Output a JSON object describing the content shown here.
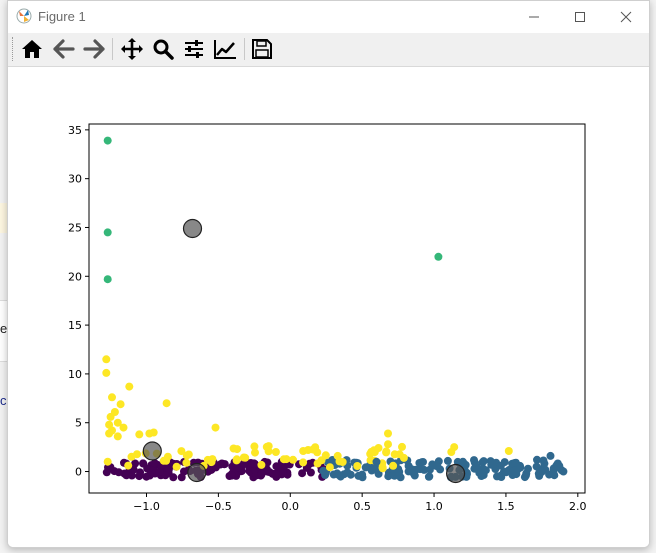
{
  "window": {
    "title": "Figure 1"
  },
  "background": {
    "fragment_1": "e",
    "fragment_2": "ch"
  },
  "toolbar": {
    "buttons": [
      {
        "name": "home-button",
        "icon": "home-icon"
      },
      {
        "name": "back-button",
        "icon": "arrow-left-icon"
      },
      {
        "name": "forward-button",
        "icon": "arrow-right-icon"
      },
      {
        "name": "pan-button",
        "icon": "move-icon"
      },
      {
        "name": "zoom-button",
        "icon": "magnifier-icon"
      },
      {
        "name": "subplots-button",
        "icon": "sliders-icon"
      },
      {
        "name": "edit-axis-button",
        "icon": "chart-line-icon"
      },
      {
        "name": "save-button",
        "icon": "floppy-disk-icon"
      }
    ]
  },
  "colors": {
    "purple": "#440154",
    "blue": "#30688e",
    "green": "#35b779",
    "yellow": "#fde725",
    "centroid": "#555555"
  },
  "chart_data": {
    "type": "scatter",
    "xlim": [
      -1.4,
      2.05
    ],
    "ylim": [
      -2.2,
      35.6
    ],
    "x_ticks": [
      -1.0,
      -0.5,
      0.0,
      0.5,
      1.0,
      1.5,
      2.0
    ],
    "x_tick_labels": [
      "−1.0",
      "−0.5",
      "0.0",
      "0.5",
      "1.0",
      "1.5",
      "2.0"
    ],
    "y_ticks": [
      0,
      5,
      10,
      15,
      20,
      25,
      30,
      35
    ],
    "y_tick_labels": [
      "0",
      "5",
      "10",
      "15",
      "20",
      "25",
      "30",
      "35"
    ],
    "grid": false,
    "clusters": [
      {
        "color": "purple",
        "x_range": [
          -1.29,
          0.26
        ],
        "y_range": [
          -0.6,
          1.0
        ],
        "count": 140
      },
      {
        "color": "blue",
        "x_range": [
          0.22,
          1.9
        ],
        "y_range": [
          -0.6,
          1.2
        ],
        "count": 140
      },
      {
        "color": "yellow",
        "x_range": [
          -1.29,
          0.8
        ],
        "y_range": [
          0.3,
          2.6
        ],
        "count": 60
      }
    ],
    "points": {
      "green": [
        [
          -1.27,
          33.9
        ],
        [
          -1.27,
          24.5
        ],
        [
          -1.27,
          19.7
        ],
        [
          1.03,
          22.0
        ]
      ],
      "yellow": [
        [
          -1.28,
          11.5
        ],
        [
          -1.28,
          10.1
        ],
        [
          -1.12,
          8.7
        ],
        [
          -0.86,
          7.0
        ],
        [
          -1.24,
          7.6
        ],
        [
          -1.18,
          6.9
        ],
        [
          -1.22,
          6.1
        ],
        [
          -1.25,
          5.6
        ],
        [
          -1.2,
          5.0
        ],
        [
          -1.26,
          4.8
        ],
        [
          -1.16,
          4.5
        ],
        [
          -1.24,
          4.2
        ],
        [
          -1.26,
          3.9
        ],
        [
          -1.2,
          3.6
        ],
        [
          -1.05,
          3.8
        ],
        [
          -0.98,
          3.9
        ],
        [
          -0.95,
          4.0
        ],
        [
          -0.52,
          4.5
        ],
        [
          -0.15,
          2.6
        ],
        [
          -0.37,
          2.3
        ],
        [
          -0.1,
          2.0
        ],
        [
          0.33,
          1.6
        ],
        [
          0.68,
          3.9
        ],
        [
          0.68,
          2.8
        ],
        [
          0.79,
          1.4
        ],
        [
          1.14,
          2.5
        ],
        [
          1.12,
          2.0
        ],
        [
          1.52,
          2.1
        ]
      ],
      "blue": [
        [
          1.81,
          1.6
        ],
        [
          1.9,
          0.0
        ],
        [
          0.6,
          1.0
        ]
      ]
    },
    "centroids": [
      [
        -0.68,
        24.9
      ],
      [
        -0.96,
        2.1
      ],
      [
        -0.65,
        -0.1
      ],
      [
        1.15,
        -0.2
      ]
    ]
  }
}
